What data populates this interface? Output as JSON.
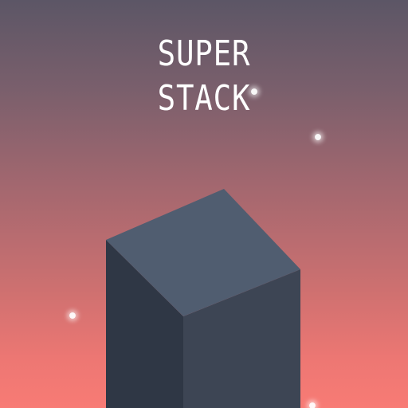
{
  "game": {
    "title_line_1": "SUPER",
    "title_line_2": "STACK"
  },
  "colors": {
    "block_top": "#505d70",
    "block_left": "#2f3745",
    "block_right": "#3d4554",
    "text": "#ffffff"
  }
}
